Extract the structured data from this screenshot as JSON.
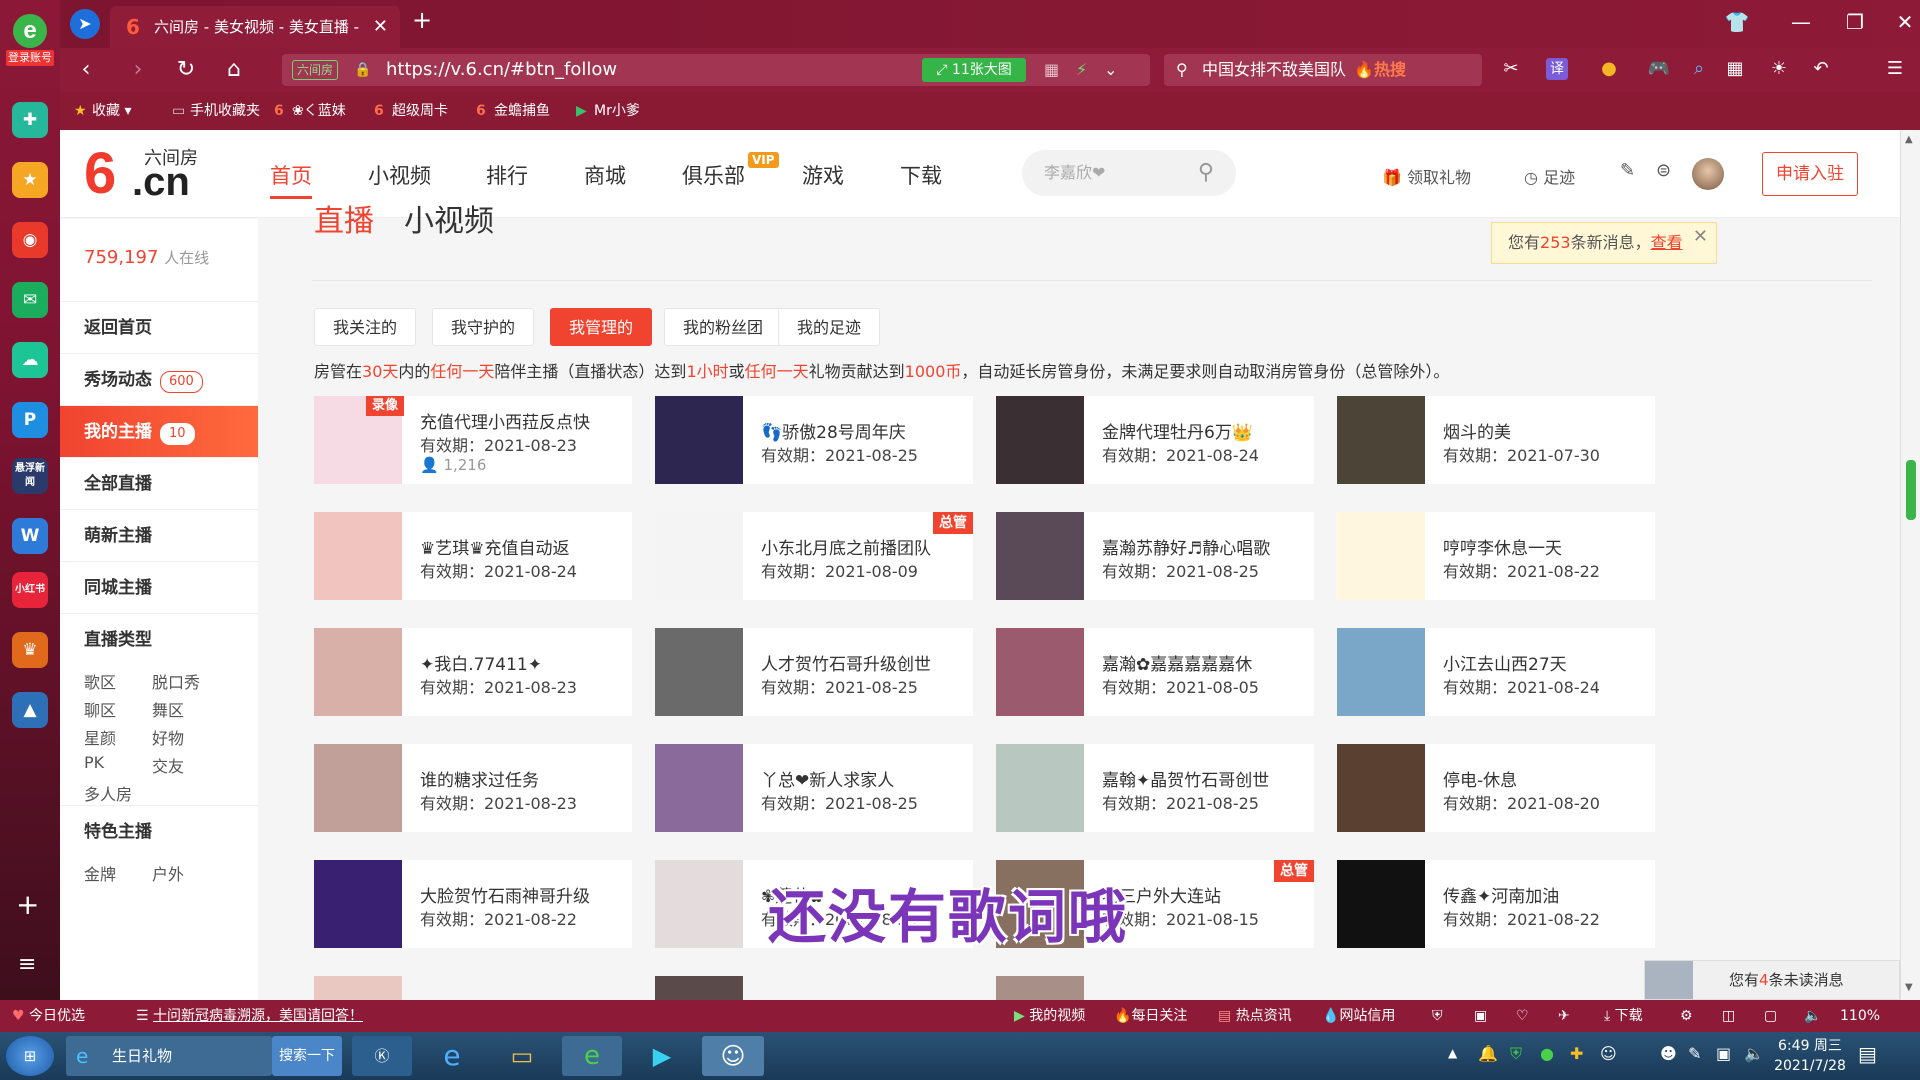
{
  "left_bar": {
    "login_label": "登录账号",
    "icons": [
      "plus-circle-icon",
      "star-icon",
      "weibo-icon",
      "mail-icon",
      "cloud-icon",
      "p-icon",
      "game-news-icon",
      "word-icon",
      "xiaohongshu-icon",
      "game-icon",
      "pubg-icon"
    ],
    "news_label": "悬浮新闻",
    "xhs_label": "小红书",
    "add_label": "+",
    "menu_label": "≡"
  },
  "browser": {
    "tab_title": "六间房 - 美女视频 - 美女直播 -",
    "new_tab": "+",
    "url": "https://v.6.cn/#btn_follow",
    "site_tag": "六间房",
    "gallery_btn": "11张大图",
    "search_text": "中国女排不敌美国队",
    "search_hot": "热搜",
    "translate": "译",
    "bookmarks": [
      "收藏",
      "手机收藏夹",
      "❀く蓝妹",
      "超级周卡",
      "金蟾捕鱼",
      "Mr小爹"
    ]
  },
  "header": {
    "logo_big": "6",
    "logo_cn": ".cn",
    "logo_zh": "六间房",
    "nav": [
      "首页",
      "小视频",
      "排行",
      "商城",
      "俱乐部",
      "游戏",
      "下载"
    ],
    "vip": "VIP",
    "search_placeholder": "李嘉欣❤",
    "gift": "领取礼物",
    "footprint": "足迹",
    "apply": "申请入驻"
  },
  "sidebar": {
    "online_count": "759,197",
    "online_label": "人在线",
    "items": [
      {
        "label": "返回首页",
        "count": ""
      },
      {
        "label": "秀场动态",
        "count": "600"
      },
      {
        "label": "我的主播",
        "count": "10"
      },
      {
        "label": "全部直播",
        "count": ""
      },
      {
        "label": "萌新主播",
        "count": ""
      },
      {
        "label": "同城主播",
        "count": ""
      }
    ],
    "type_title": "直播类型",
    "types": [
      "歌区",
      "脱口秀",
      "聊区",
      "舞区",
      "星颜",
      "好物",
      "PK",
      "交友",
      "多人房"
    ],
    "special_title": "特色主播",
    "special_partial": [
      "金牌",
      "户外"
    ]
  },
  "content": {
    "tabs": [
      "直播",
      "小视频"
    ],
    "subtabs": [
      "我关注的",
      "我守护的",
      "我管理的",
      "我的粉丝团",
      "我的足迹"
    ],
    "notice": {
      "p1": "房管在",
      "d1": "30天",
      "p2": "内的",
      "d2": "任何一天",
      "p3": "陪伴主播（直播状态）达到",
      "d3": "1小时",
      "p4": "或",
      "d4": "任何一天",
      "p5": "礼物贡献达到",
      "d5": "1000币",
      "p6": "，自动延长房管身份，未满足要求则自动取消房管身份（总管除外）。"
    },
    "expiry_label": "有效期：",
    "cards": [
      {
        "name": "充值代理小西菈反点快",
        "date": "2021-08-23",
        "viewers": "1,216",
        "badge": "录像",
        "bg": "#f7dbe4"
      },
      {
        "name": "👣骄傲28号周年庆",
        "date": "2021-08-25",
        "badge": "",
        "bg": "#2d2650"
      },
      {
        "name": "金牌代理牡丹6万👑",
        "date": "2021-08-24",
        "badge": "",
        "bg": "#3a3034"
      },
      {
        "name": "烟斗的美",
        "date": "2021-07-30",
        "badge": "",
        "bg": "#4c4436"
      },
      {
        "name": "♛艺琪♛充值自动返",
        "date": "2021-08-24",
        "badge": "",
        "bg": "#f2c4c0"
      },
      {
        "name": "小东北月底之前播团队",
        "date": "2021-08-09",
        "badge": "总管",
        "bg": "#f4f4f4"
      },
      {
        "name": "嘉瀚苏静好♬静心唱歌",
        "date": "2021-08-25",
        "badge": "",
        "bg": "#5a4a58"
      },
      {
        "name": "哼哼李休息一天",
        "date": "2021-08-22",
        "badge": "",
        "bg": "#fff6e0"
      },
      {
        "name": "✦我白.77411✦",
        "date": "2021-08-23",
        "badge": "",
        "bg": "#d8b0a8"
      },
      {
        "name": "人才贺竹石哥升级创世",
        "date": "2021-08-25",
        "badge": "",
        "bg": "#6a6a6a"
      },
      {
        "name": "嘉瀚✿嘉嘉嘉嘉嘉休",
        "date": "2021-08-05",
        "badge": "",
        "bg": "#9c5a6e"
      },
      {
        "name": "小江去山西27天",
        "date": "2021-08-24",
        "badge": "",
        "bg": "#7aa6c8"
      },
      {
        "name": "谁的糖求过任务",
        "date": "2021-08-23",
        "badge": "",
        "bg": "#c0a098"
      },
      {
        "name": "丫总❤新人求家人",
        "date": "2021-08-25",
        "badge": "",
        "bg": "#8a6a9a"
      },
      {
        "name": "嘉翰✦晶贺竹石哥创世",
        "date": "2021-08-25",
        "badge": "",
        "bg": "#b8c8c0"
      },
      {
        "name": "停电-休息",
        "date": "2021-08-20",
        "badge": "",
        "bg": "#5a4030"
      },
      {
        "name": "大脸贺竹石雨神哥升级",
        "date": "2021-08-22",
        "badge": "",
        "bg": "#3a2070"
      },
      {
        "name": "✾莲花✿",
        "date": "2021-08-24",
        "badge": "",
        "bg": "#e4dcdc"
      },
      {
        "name": "老三户外大连站",
        "date": "2021-08-15",
        "badge": "总管",
        "bg": "#887060"
      },
      {
        "name": "传鑫✦河南加油",
        "date": "2021-08-22",
        "badge": "",
        "bg": "#111111"
      }
    ],
    "msg_tip": {
      "before": "您有",
      "num": "253",
      "after": "条新消息，",
      "link": "查看"
    },
    "unread": {
      "before": "您有",
      "num": "4",
      "after": "条未读消息"
    },
    "lyric": "还没有歌词哦"
  },
  "status_bar": {
    "today": "今日优选",
    "news": "十问新冠病毒溯源，美国请回答！",
    "my_video": "我的视频",
    "daily": "每日关注",
    "hot_news": "热点资讯",
    "credit": "网站信用",
    "download": "下载",
    "zoom": "110%"
  },
  "taskbar": {
    "window1": "生日礼物",
    "search_btn": "搜索一下",
    "time": "6:49 周三",
    "date": "2021/7/28"
  },
  "colors": {
    "brand": "#f04430",
    "browser_chrome": "#8d1b37",
    "accent_green": "#35b548"
  }
}
